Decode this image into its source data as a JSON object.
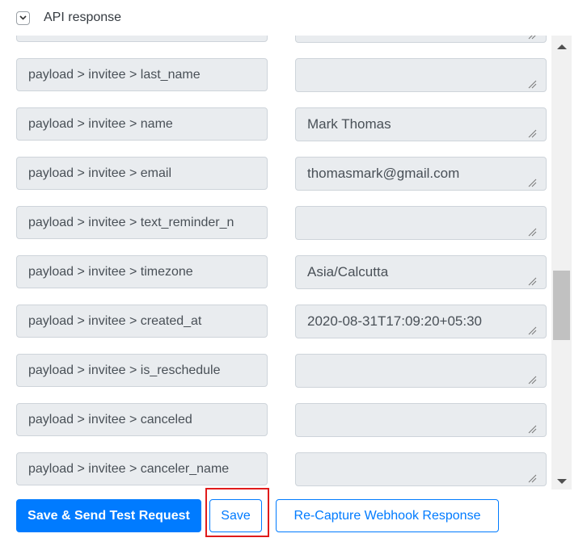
{
  "header": {
    "title": "API response",
    "toggle_icon": "chevron-down-icon",
    "expanded": true
  },
  "fields": [
    {
      "key": "",
      "value": ""
    },
    {
      "key": "payload > invitee > last_name",
      "value": ""
    },
    {
      "key": "payload > invitee > name",
      "value": "Mark Thomas"
    },
    {
      "key": "payload > invitee > email",
      "value": "thomasmark@gmail.com"
    },
    {
      "key": "payload > invitee > text_reminder_n",
      "value": ""
    },
    {
      "key": "payload > invitee > timezone",
      "value": "Asia/Calcutta"
    },
    {
      "key": "payload > invitee > created_at",
      "value": "2020-08-31T17:09:20+05:30"
    },
    {
      "key": "payload > invitee > is_reschedule",
      "value": ""
    },
    {
      "key": "payload > invitee > canceled",
      "value": ""
    },
    {
      "key": "payload > invitee > canceler_name",
      "value": ""
    }
  ],
  "scrollbar": {
    "up_icon": "triangle-up-icon",
    "down_icon": "triangle-down-icon",
    "scroll_position": 0.55
  },
  "actions": {
    "send_test_label": "Save & Send Test Request",
    "save_label": "Save",
    "recapture_label": "Re-Capture Webhook Response"
  },
  "colors": {
    "primary": "#007bff",
    "highlight": "#e01b1b",
    "field_bg": "#e9ecef"
  }
}
